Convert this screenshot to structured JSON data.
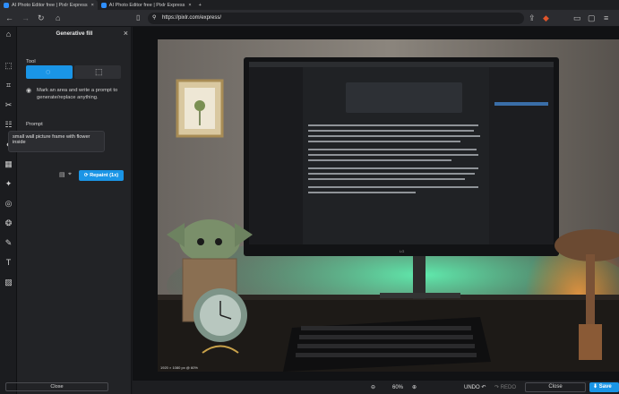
{
  "browser": {
    "tabs": [
      {
        "title": "AI Photo Editor free | Pixlr Express",
        "active": true
      },
      {
        "title": "AI Photo Editor free | Pixlr Express",
        "active": false
      }
    ],
    "url": "https://pixlr.com/express/"
  },
  "panel": {
    "title": "Generative fill",
    "tool_label": "Tool",
    "hint": "Mark an area and write a prompt to generate/replace anything.",
    "prompt_label": "Prompt",
    "prompt_value": "small wall picture frame with flower inside",
    "repaint_label": "Repaint (1x)",
    "close_label": "Close"
  },
  "photo": {
    "info": "1920 × 1080 px @ 60%",
    "monitor_brand": "LG"
  },
  "bottom": {
    "zoom": "60%",
    "undo": "UNDO",
    "redo": "REDO",
    "close": "Close",
    "save": "Save"
  },
  "colors": {
    "accent": "#1a95e6",
    "panel_bg": "#222326",
    "rail_bg": "#1b1c1f"
  },
  "icons": [
    "menu-icon",
    "home-icon",
    "arrange-icon",
    "crop-icon",
    "cutout-icon",
    "adjust-icon",
    "filter-icon",
    "effect-icon",
    "ai-icon",
    "liquify-icon",
    "retouch-icon",
    "brush-icon",
    "text-icon",
    "pattern-icon"
  ]
}
